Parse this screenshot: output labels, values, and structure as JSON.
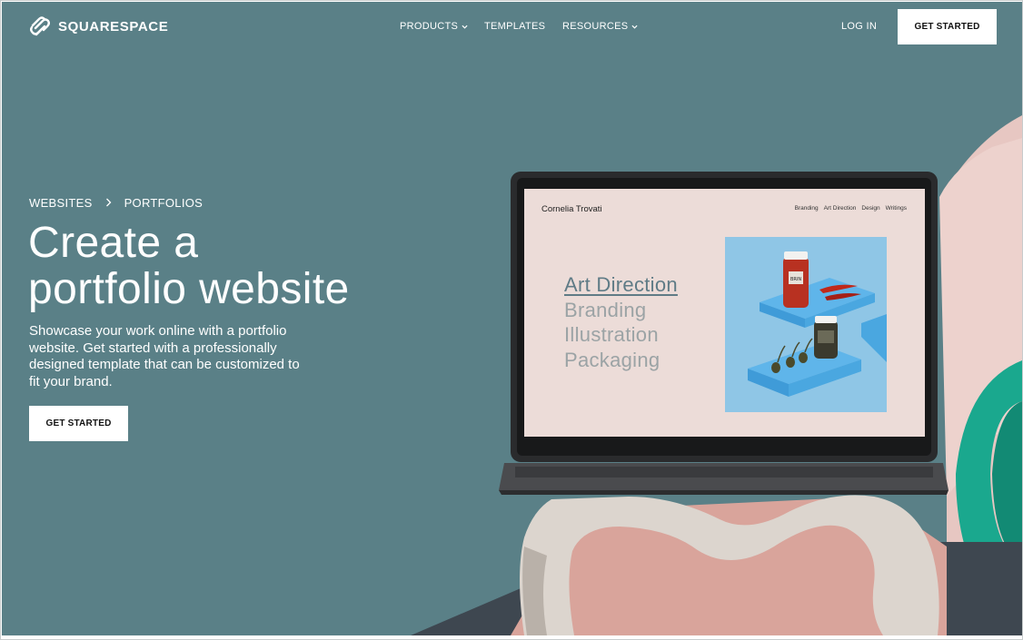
{
  "nav": {
    "logo_text": "SQUARESPACE",
    "links": [
      {
        "label": "PRODUCTS",
        "has_dropdown": true
      },
      {
        "label": "TEMPLATES",
        "has_dropdown": false
      },
      {
        "label": "RESOURCES",
        "has_dropdown": true
      }
    ],
    "login_label": "LOG IN",
    "cta_label": "GET STARTED"
  },
  "hero": {
    "breadcrumb": [
      "WEBSITES",
      "PORTFOLIOS"
    ],
    "headline_line1": "Create a",
    "headline_line2": "portfolio website",
    "description": "Showcase your work online with a portfolio website. Get started with a professionally designed template that can be customized to fit your brand.",
    "cta_label": "GET STARTED"
  },
  "laptop_preview": {
    "site_name": "Cornelia Trovati",
    "site_nav": [
      "Branding",
      "Art Direction",
      "Design",
      "Writings"
    ],
    "list_items": [
      "Art Direction",
      "Branding",
      "Illustration",
      "Packaging"
    ],
    "active_item": "Art Direction",
    "jar_label": "BRIN"
  },
  "colors": {
    "hero_bg": "#5a8087",
    "screen_bg": "#ecdcd8",
    "photo_bg": "#8fc6e6",
    "accent_teal": "#1aa88e",
    "active_link": "#5f7b86"
  },
  "icons": {
    "logo": "squarespace-logo-icon",
    "dropdown": "chevron-down-icon",
    "breadcrumb_separator": "chevron-right-icon"
  }
}
